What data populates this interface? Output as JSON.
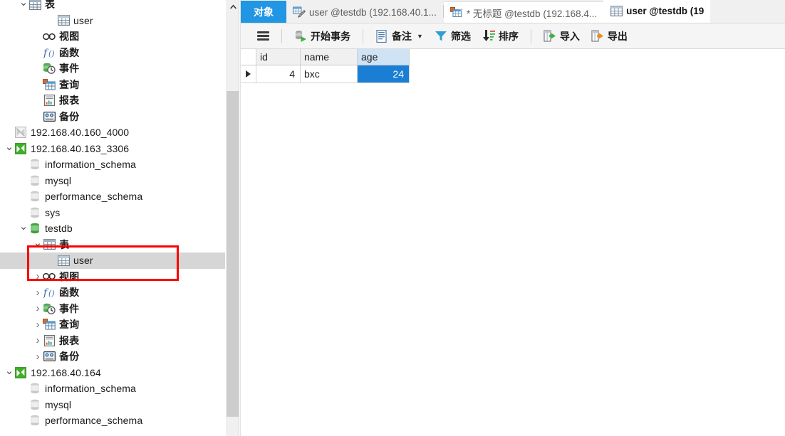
{
  "app": {
    "accent_blue": "#2196e3",
    "selection_blue": "#1a7fd4",
    "selected_row_gray": "#d6d6d6",
    "annotation_red": "#ff0000"
  },
  "sidebar": {
    "scrollbar": {
      "up_arrow": "scroll-up-arrow"
    },
    "nodes": [
      {
        "id": "tables-160",
        "label": "表",
        "indent": 1,
        "chev": "down",
        "icon": "table-group-icon",
        "selected": false
      },
      {
        "id": "table-user-160",
        "label": "user",
        "indent": 3,
        "chev": "none",
        "icon": "table-icon",
        "selected": false
      },
      {
        "id": "views-160",
        "label": "视图",
        "indent": 2,
        "chev": "none",
        "icon": "view-icon",
        "selected": false
      },
      {
        "id": "functions-160",
        "label": "函数",
        "indent": 2,
        "chev": "none",
        "icon": "function-icon",
        "selected": false
      },
      {
        "id": "events-160",
        "label": "事件",
        "indent": 2,
        "chev": "none",
        "icon": "event-icon",
        "selected": false
      },
      {
        "id": "queries-160",
        "label": "查询",
        "indent": 2,
        "chev": "none",
        "icon": "query-icon",
        "selected": false
      },
      {
        "id": "reports-160",
        "label": "报表",
        "indent": 2,
        "chev": "none",
        "icon": "report-icon",
        "selected": false
      },
      {
        "id": "backups-160",
        "label": "备份",
        "indent": 2,
        "chev": "none",
        "icon": "backup-icon",
        "selected": false
      },
      {
        "id": "conn-160",
        "label": "192.168.40.160_4000",
        "indent": 0,
        "chev": "none",
        "icon": "connection-gray-icon",
        "selected": false
      },
      {
        "id": "conn-163",
        "label": "192.168.40.163_3306",
        "indent": 0,
        "chev": "down",
        "icon": "connection-green-icon",
        "selected": false
      },
      {
        "id": "db-163-info",
        "label": "information_schema",
        "indent": 1,
        "chev": "none",
        "icon": "database-gray-icon",
        "selected": false
      },
      {
        "id": "db-163-mysql",
        "label": "mysql",
        "indent": 1,
        "chev": "none",
        "icon": "database-gray-icon",
        "selected": false
      },
      {
        "id": "db-163-perf",
        "label": "performance_schema",
        "indent": 1,
        "chev": "none",
        "icon": "database-gray-icon",
        "selected": false
      },
      {
        "id": "db-163-sys",
        "label": "sys",
        "indent": 1,
        "chev": "none",
        "icon": "database-gray-icon",
        "selected": false
      },
      {
        "id": "db-163-testdb",
        "label": "testdb",
        "indent": 1,
        "chev": "down",
        "icon": "database-green-icon",
        "selected": false
      },
      {
        "id": "tables-testdb",
        "label": "表",
        "indent": 2,
        "chev": "down",
        "icon": "table-group-icon",
        "selected": false
      },
      {
        "id": "table-user-testdb",
        "label": "user",
        "indent": 3,
        "chev": "none",
        "icon": "table-icon",
        "selected": true
      },
      {
        "id": "views-testdb",
        "label": "视图",
        "indent": 2,
        "chev": "right",
        "icon": "view-icon",
        "selected": false
      },
      {
        "id": "functions-testdb",
        "label": "函数",
        "indent": 2,
        "chev": "right",
        "icon": "function-icon",
        "selected": false
      },
      {
        "id": "events-testdb",
        "label": "事件",
        "indent": 2,
        "chev": "right",
        "icon": "event-icon",
        "selected": false
      },
      {
        "id": "queries-testdb",
        "label": "查询",
        "indent": 2,
        "chev": "right",
        "icon": "query-icon",
        "selected": false
      },
      {
        "id": "reports-testdb",
        "label": "报表",
        "indent": 2,
        "chev": "right",
        "icon": "report-icon",
        "selected": false
      },
      {
        "id": "backups-testdb",
        "label": "备份",
        "indent": 2,
        "chev": "right",
        "icon": "backup-icon",
        "selected": false
      },
      {
        "id": "conn-164",
        "label": "192.168.40.164",
        "indent": 0,
        "chev": "down",
        "icon": "connection-green-icon",
        "selected": false
      },
      {
        "id": "db-164-info",
        "label": "information_schema",
        "indent": 1,
        "chev": "none",
        "icon": "database-gray-icon",
        "selected": false
      },
      {
        "id": "db-164-mysql",
        "label": "mysql",
        "indent": 1,
        "chev": "none",
        "icon": "database-gray-icon",
        "selected": false
      },
      {
        "id": "db-164-perf",
        "label": "performance_schema",
        "indent": 1,
        "chev": "none",
        "icon": "database-gray-icon",
        "selected": false
      }
    ]
  },
  "tabs": [
    {
      "id": "objects",
      "label": "对象",
      "icon": "none",
      "state": "accent"
    },
    {
      "id": "table-designer",
      "label": "user @testdb (192.168.40.1...",
      "icon": "table-designer-icon",
      "state": "inactive"
    },
    {
      "id": "query-untitled",
      "label": "* 无标题 @testdb (192.168.4...",
      "icon": "query-editor-icon",
      "state": "inactive2"
    },
    {
      "id": "table-data",
      "label": "user @testdb (19",
      "icon": "table-icon",
      "state": "active"
    }
  ],
  "toolbar": {
    "menu_icon": "hamburger-menu-icon",
    "buttons": [
      {
        "id": "begin-transaction",
        "label": "开始事务",
        "icon": "begin-transaction-icon",
        "caret": false
      },
      {
        "id": "note",
        "label": "备注",
        "icon": "note-icon",
        "caret": true
      },
      {
        "id": "filter",
        "label": "筛选",
        "icon": "filter-icon",
        "caret": false
      },
      {
        "id": "sort",
        "label": "排序",
        "icon": "sort-icon",
        "caret": false
      },
      {
        "id": "import",
        "label": "导入",
        "icon": "import-icon",
        "caret": false
      },
      {
        "id": "export",
        "label": "导出",
        "icon": "export-icon",
        "caret": false
      }
    ]
  },
  "grid": {
    "columns": [
      "id",
      "name",
      "age"
    ],
    "selected_column": "age",
    "rows": [
      {
        "marker": "current-row-arrow",
        "id": "4",
        "name": "bxc",
        "age": "24"
      }
    ],
    "selected_cell": {
      "row": 0,
      "column": "age",
      "value": "24"
    }
  },
  "annotation": {
    "type": "red-rectangle-highlight",
    "target": "table-user-testdb"
  }
}
